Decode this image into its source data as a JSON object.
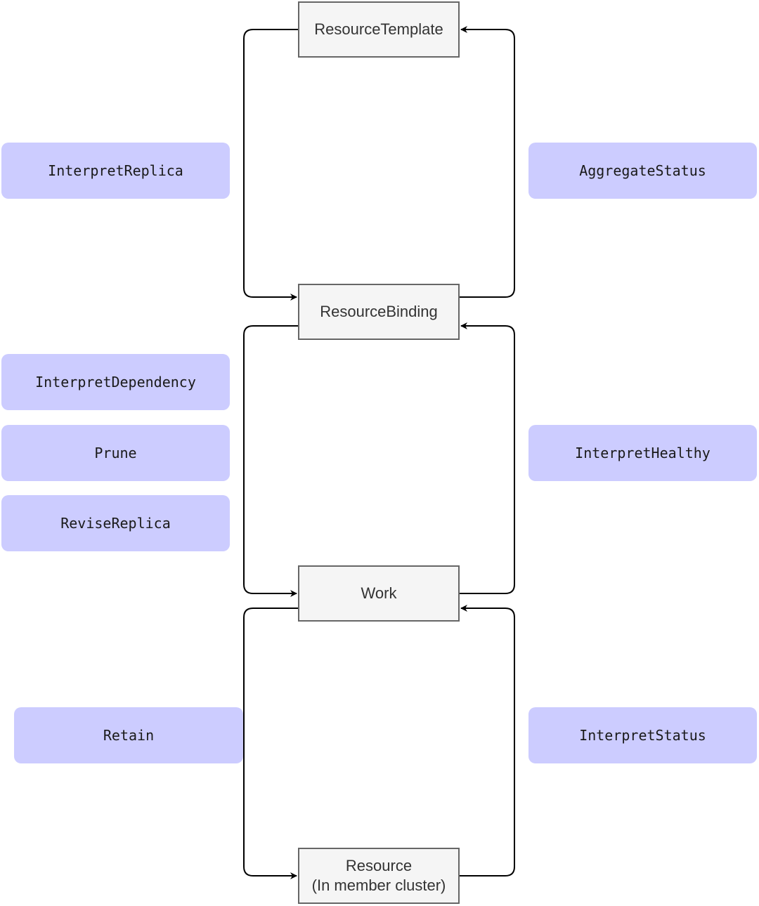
{
  "nodes": {
    "resource_template": "ResourceTemplate",
    "resource_binding": "ResourceBinding",
    "work": "Work",
    "resource_line1": "Resource",
    "resource_line2": "(In member cluster)"
  },
  "hooks": {
    "interpret_replica": "InterpretReplica",
    "aggregate_status": "AggregateStatus",
    "interpret_dependency": "InterpretDependency",
    "prune": "Prune",
    "revise_replica": "ReviseReplica",
    "interpret_healthy": "InterpretHealthy",
    "retain": "Retain",
    "interpret_status": "InterpretStatus"
  },
  "colors": {
    "hook_fill": "#ccccff",
    "node_fill": "#f5f5f5",
    "node_border": "#666666",
    "edge": "#000000"
  }
}
